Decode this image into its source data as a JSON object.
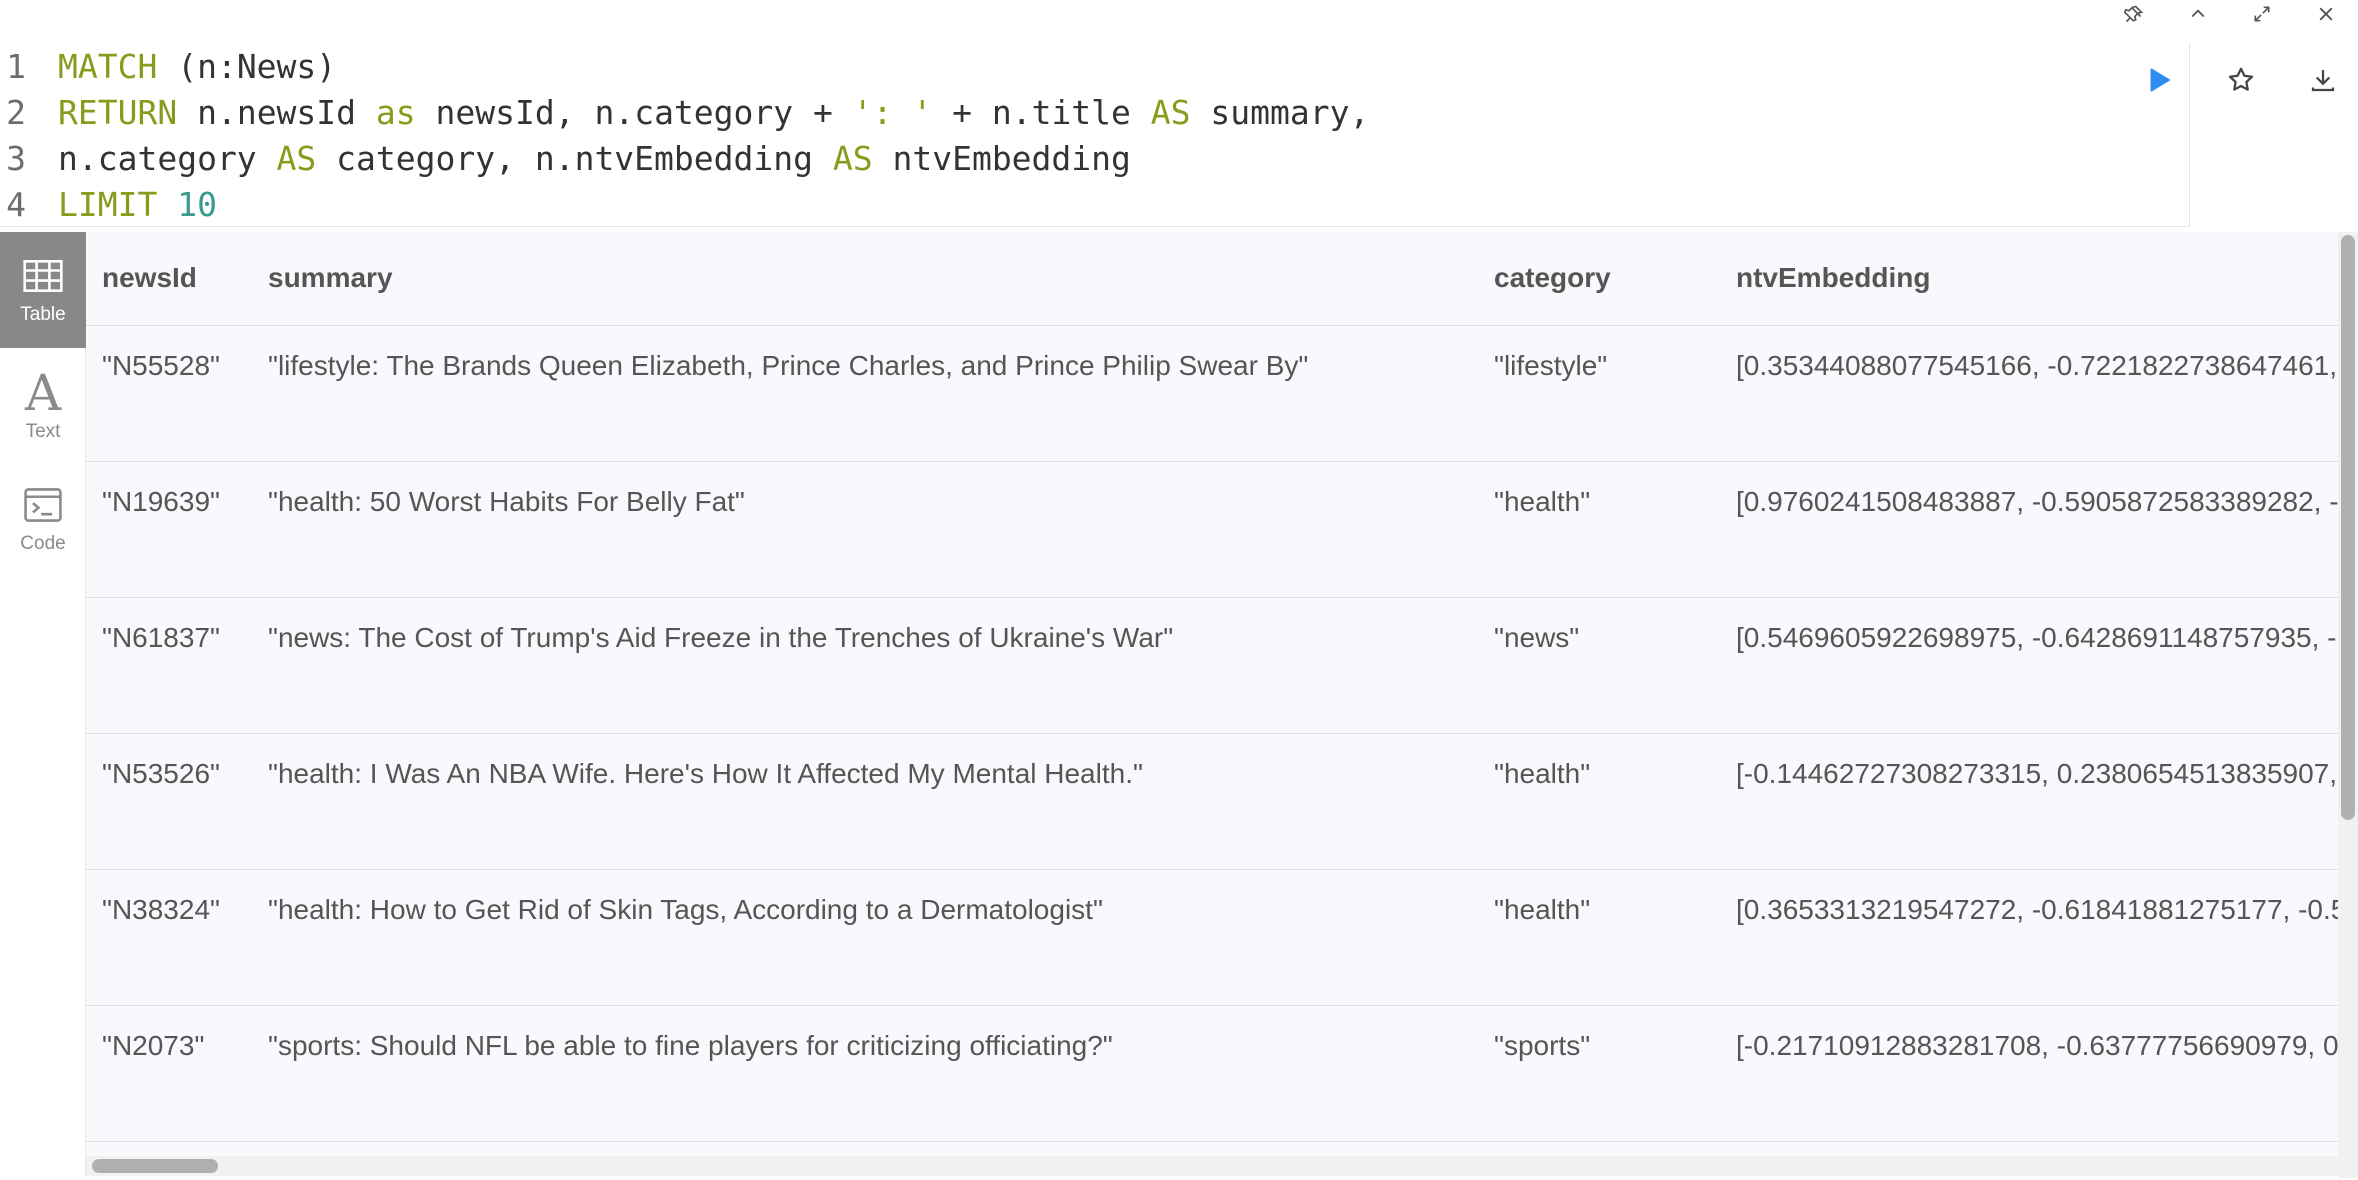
{
  "window_controls": [
    {
      "name": "pin-icon"
    },
    {
      "name": "chevron-up-icon"
    },
    {
      "name": "expand-icon"
    },
    {
      "name": "close-icon"
    }
  ],
  "editor": {
    "lines": [
      {
        "num": "1",
        "tokens": [
          {
            "t": "MATCH",
            "c": "kw"
          },
          {
            "t": " (n:News)",
            "c": "tx"
          }
        ]
      },
      {
        "num": "2",
        "tokens": [
          {
            "t": "RETURN",
            "c": "kw"
          },
          {
            "t": " n.newsId ",
            "c": "tx"
          },
          {
            "t": "as",
            "c": "kw"
          },
          {
            "t": " newsId, n.category + ",
            "c": "tx"
          },
          {
            "t": "': '",
            "c": "st"
          },
          {
            "t": " + n.title ",
            "c": "tx"
          },
          {
            "t": "AS",
            "c": "kw"
          },
          {
            "t": " summary,",
            "c": "tx"
          }
        ]
      },
      {
        "num": "3",
        "tokens": [
          {
            "t": "n.category ",
            "c": "tx"
          },
          {
            "t": "AS",
            "c": "kw"
          },
          {
            "t": " category, n.ntvEmbedding ",
            "c": "tx"
          },
          {
            "t": "AS",
            "c": "kw"
          },
          {
            "t": " ntvEmbedding",
            "c": "tx"
          }
        ]
      },
      {
        "num": "4",
        "tokens": [
          {
            "t": "LIMIT",
            "c": "kw"
          },
          {
            "t": " ",
            "c": "tx"
          },
          {
            "t": "10",
            "c": "nm"
          }
        ]
      }
    ],
    "actions": [
      {
        "name": "run-icon",
        "color": "#2d8cf0"
      },
      {
        "name": "star-icon"
      },
      {
        "name": "download-icon"
      }
    ]
  },
  "sidebar": {
    "items": [
      {
        "label": "Table",
        "icon": "table-icon",
        "active": true
      },
      {
        "label": "Text",
        "icon": "text-icon",
        "active": false
      },
      {
        "label": "Code",
        "icon": "code-icon",
        "active": false
      }
    ]
  },
  "table": {
    "columns": [
      "newsId",
      "summary",
      "category",
      "ntvEmbedding"
    ],
    "rows": [
      [
        "\"N55528\"",
        "\"lifestyle: The Brands Queen Elizabeth, Prince Charles, and Prince Philip Swear By\"",
        "\"lifestyle\"",
        "[0.35344088077545166, -0.7221822738647461,"
      ],
      [
        "\"N19639\"",
        "\"health: 50 Worst Habits For Belly Fat\"",
        "\"health\"",
        "[0.9760241508483887, -0.5905872583389282, -"
      ],
      [
        "\"N61837\"",
        "\"news: The Cost of Trump's Aid Freeze in the Trenches of Ukraine's War\"",
        "\"news\"",
        "[0.5469605922698975, -0.6428691148757935, -"
      ],
      [
        "\"N53526\"",
        "\"health: I Was An NBA Wife. Here's How It Affected My Mental Health.\"",
        "\"health\"",
        "[-0.14462727308273315, 0.2380654513835907,"
      ],
      [
        "\"N38324\"",
        "\"health: How to Get Rid of Skin Tags, According to a Dermatologist\"",
        "\"health\"",
        "[0.3653313219547272, -0.61841881275177, -0.5"
      ],
      [
        "\"N2073\"",
        "\"sports: Should NFL be able to fine players for criticizing officiating?\"",
        "\"sports\"",
        "[-0.21710912883281708, -0.63777756690979, 0"
      ]
    ]
  }
}
